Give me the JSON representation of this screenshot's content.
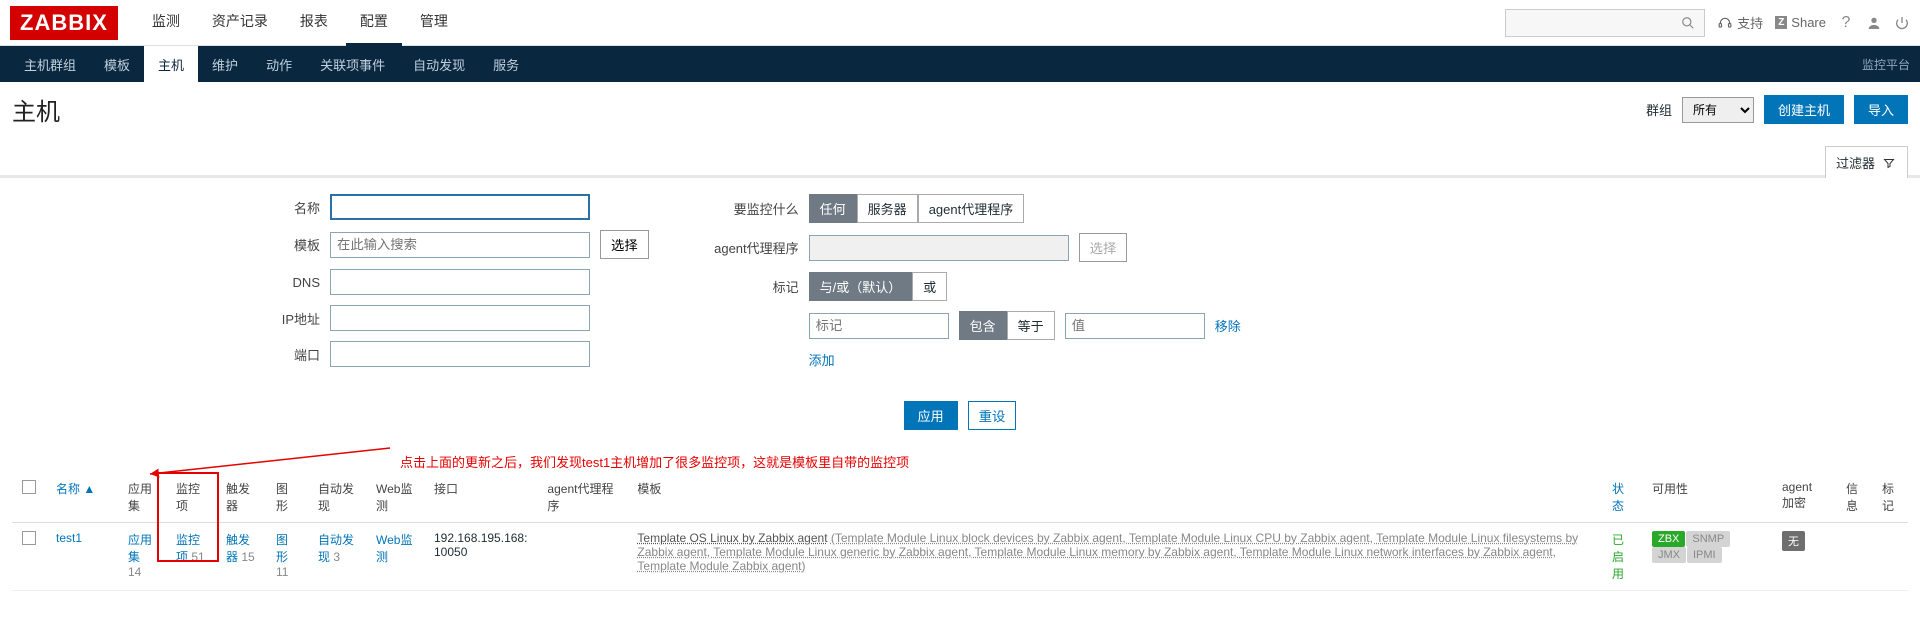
{
  "brand": "ZABBIX",
  "topnav": {
    "items": [
      "监测",
      "资产记录",
      "报表",
      "配置",
      "管理"
    ],
    "active_index": 3,
    "support": "支持",
    "share": "Share"
  },
  "subnav": {
    "items": [
      "主机群组",
      "模板",
      "主机",
      "维护",
      "动作",
      "关联项事件",
      "自动发现",
      "服务"
    ],
    "active_index": 2,
    "right": "监控平台"
  },
  "page": {
    "title": "主机",
    "group_label": "群组",
    "group_value": "所有",
    "create_btn": "创建主机",
    "import_btn": "导入",
    "filter_tab": "过滤器"
  },
  "filter": {
    "left": {
      "name_label": "名称",
      "template_label": "模板",
      "template_placeholder": "在此输入搜索",
      "template_select_btn": "选择",
      "dns_label": "DNS",
      "ip_label": "IP地址",
      "port_label": "端口"
    },
    "right": {
      "monitor_label": "要监控什么",
      "monitor_options": [
        "任何",
        "服务器",
        "agent代理程序"
      ],
      "monitor_active": 0,
      "proxy_label": "agent代理程序",
      "proxy_select_btn": "选择",
      "tag_label": "标记",
      "tag_mode_options": [
        "与/或（默认）",
        "或"
      ],
      "tag_mode_active": 0,
      "tag_name_placeholder": "标记",
      "tag_op_options": [
        "包含",
        "等于"
      ],
      "tag_op_active": 0,
      "tag_value_placeholder": "值",
      "tag_remove": "移除",
      "tag_add": "添加"
    },
    "actions": {
      "apply": "应用",
      "reset": "重设"
    }
  },
  "annotation": "点击上面的更新之后，我们发现test1主机增加了很多监控项，这就是模板里自带的监控项",
  "table": {
    "headers": {
      "name": "名称",
      "apps": "应用集",
      "items": "监控项",
      "triggers": "触发器",
      "graphs": "图形",
      "discovery": "自动发现",
      "web": "Web监测",
      "interface": "接口",
      "proxy": "agent代理程序",
      "templates": "模板",
      "status": "状态",
      "availability": "可用性",
      "agent_enc": "agent 加密",
      "info": "信息",
      "tags": "标记"
    },
    "rows": [
      {
        "name": "test1",
        "apps": {
          "label": "应用集",
          "count": "14"
        },
        "items": {
          "label": "监控项",
          "count": "51"
        },
        "triggers": {
          "label": "触发器",
          "count": "15"
        },
        "graphs": {
          "label": "图形",
          "count": "11"
        },
        "discovery": {
          "label": "自动发现",
          "count": "3"
        },
        "web": {
          "label": "Web监测",
          "count": ""
        },
        "interface": "192.168.195.168: 10050",
        "proxy": "",
        "templates_main": "Template OS Linux by Zabbix agent",
        "templates_sub": "(Template Module Linux block devices by Zabbix agent, Template Module Linux CPU by Zabbix agent, Template Module Linux filesystems by Zabbix agent, Template Module Linux generic by Zabbix agent, Template Module Linux memory by Zabbix agent, Template Module Linux network interfaces by Zabbix agent, Template Module Zabbix agent)",
        "status": "已启用",
        "availability": {
          "zbx": "ZBX",
          "snmp": "SNMP",
          "jmx": "JMX",
          "ipmi": "IPMI"
        },
        "agent_enc": "无"
      }
    ]
  }
}
